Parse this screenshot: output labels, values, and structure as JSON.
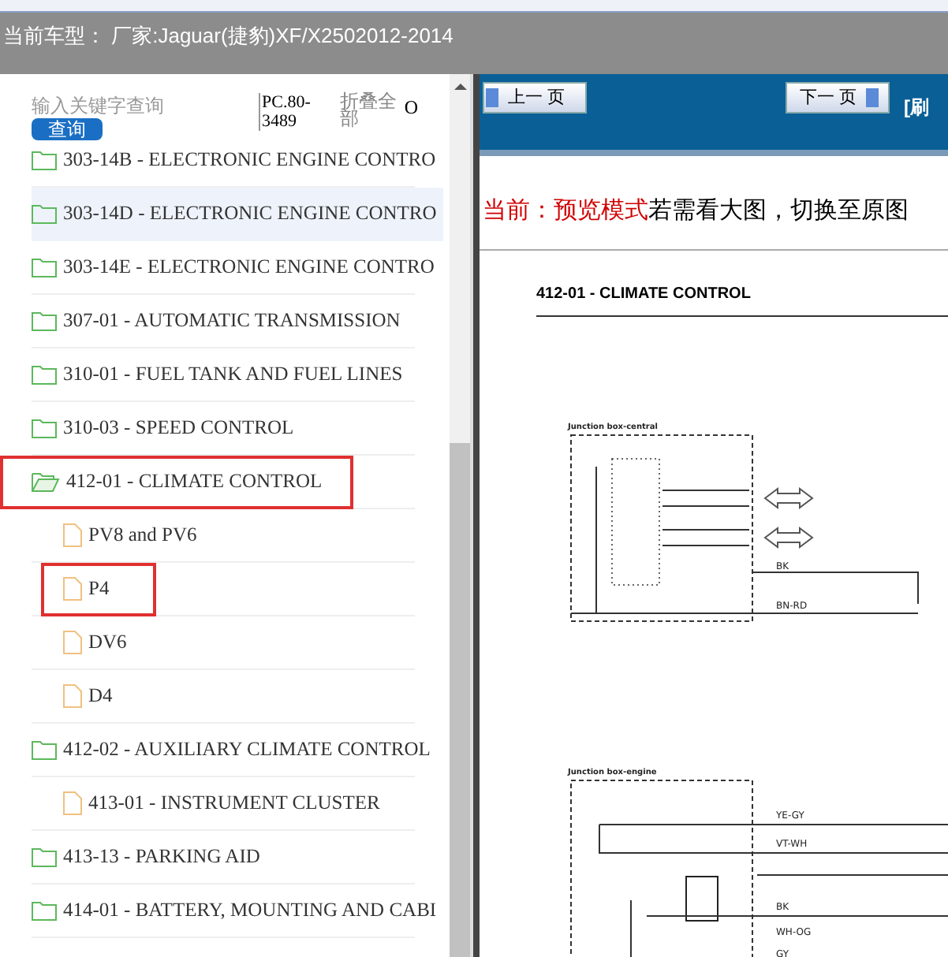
{
  "header": {
    "title": "当前车型：  厂家:Jaguar(捷豹)XF/X2502012-2014"
  },
  "search": {
    "placeholder": "输入关键字查询",
    "button": "查询",
    "code": "PC.80-3489",
    "collapse": "折叠全部",
    "extra": "O"
  },
  "tree": [
    {
      "label": "303-14B - ELECTRONIC ENGINE CONTRO",
      "kind": "folder",
      "expanded": false,
      "selected": false,
      "marked": false
    },
    {
      "label": "303-14D - ELECTRONIC ENGINE CONTRO",
      "kind": "folder",
      "expanded": false,
      "selected": true,
      "marked": false
    },
    {
      "label": "303-14E - ELECTRONIC ENGINE CONTRO",
      "kind": "folder",
      "expanded": false,
      "selected": false,
      "marked": false
    },
    {
      "label": "307-01 - AUTOMATIC TRANSMISSION",
      "kind": "folder",
      "expanded": false,
      "selected": false,
      "marked": false
    },
    {
      "label": "310-01 - FUEL TANK AND FUEL LINES",
      "kind": "folder",
      "expanded": false,
      "selected": false,
      "marked": false
    },
    {
      "label": "310-03 - SPEED CONTROL",
      "kind": "folder",
      "expanded": false,
      "selected": false,
      "marked": false
    },
    {
      "label": "412-01 - CLIMATE CONTROL",
      "kind": "folder",
      "expanded": true,
      "selected": false,
      "marked": true,
      "children": [
        {
          "label": "PV8 and PV6",
          "kind": "file",
          "selected": false,
          "marked": false
        },
        {
          "label": "P4",
          "kind": "file",
          "selected": false,
          "marked": true
        },
        {
          "label": "DV6",
          "kind": "file",
          "selected": false,
          "marked": false
        },
        {
          "label": "D4",
          "kind": "file",
          "selected": false,
          "marked": false
        }
      ]
    },
    {
      "label": "412-02 - AUXILIARY CLIMATE CONTROL",
      "kind": "folder",
      "expanded": false,
      "selected": false,
      "marked": false,
      "children": [
        {
          "label": "413-01 - INSTRUMENT CLUSTER",
          "kind": "file",
          "selected": false,
          "marked": false
        }
      ]
    },
    {
      "label": "413-13 - PARKING AID",
      "kind": "folder",
      "expanded": false,
      "selected": false,
      "marked": false
    },
    {
      "label": "414-01 - BATTERY, MOUNTING AND CABI",
      "kind": "folder",
      "expanded": false,
      "selected": false,
      "marked": false
    }
  ],
  "toolbar": {
    "prev": "上一 页",
    "next": "下一 页",
    "refresh": "[刷"
  },
  "notice": {
    "mode": "当前：预览模式",
    "text": "若需看大图，切换至原图"
  },
  "document": {
    "title": "412-01 - CLIMATE CONTROL",
    "diagram_1": {
      "title": "Junction box-central",
      "wires": [
        "BK",
        "BN-RD"
      ]
    },
    "diagram_2": {
      "title": "Junction box-engine",
      "wires": [
        "YE-GY",
        "VT-WH",
        "BK",
        "WH-OG",
        "GY"
      ]
    }
  }
}
